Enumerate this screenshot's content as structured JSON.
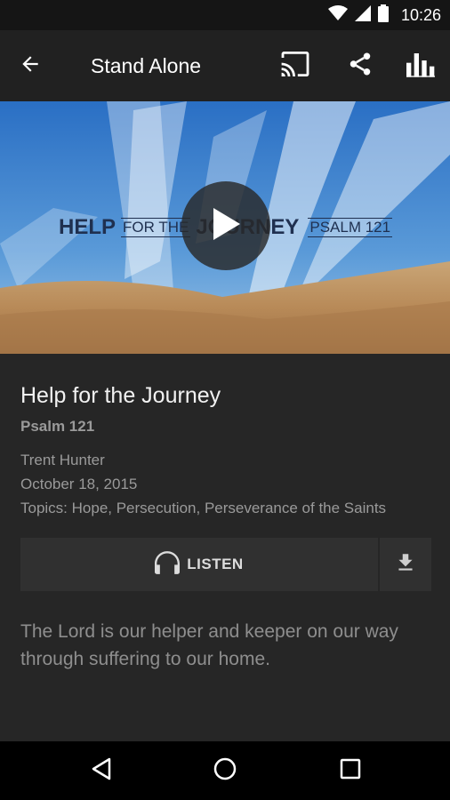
{
  "status_bar": {
    "time": "10:26",
    "icons": [
      "wifi-icon",
      "cell-signal-icon",
      "battery-icon"
    ]
  },
  "app_bar": {
    "title": "Stand Alone",
    "actions": [
      "cast-icon",
      "share-icon",
      "equalizer-icon"
    ]
  },
  "hero": {
    "image_text": {
      "help": "HELP",
      "for_the": "FOR THE",
      "journey": "JOURNEY",
      "psalm": "PSALM 121"
    },
    "play_icon": "play-icon"
  },
  "sermon": {
    "title": "Help for the Journey",
    "scripture": "Psalm 121",
    "speaker": "Trent Hunter",
    "date": "October 18, 2015",
    "topics": "Topics: Hope, Persecution, Perseverance of the Saints"
  },
  "actions": {
    "listen_label": "LISTEN",
    "listen_icon": "headphones-icon",
    "download_icon": "download-icon"
  },
  "description": "The Lord is our helper and keeper on our way through suffering to our home.",
  "nav_bar": {
    "buttons": [
      "back-triangle-icon",
      "home-circle-icon",
      "recents-square-icon"
    ]
  },
  "colors": {
    "app_bar": "#212121",
    "background": "#262626",
    "button_bg": "#303030",
    "secondary_text": "#9a9a9a"
  }
}
